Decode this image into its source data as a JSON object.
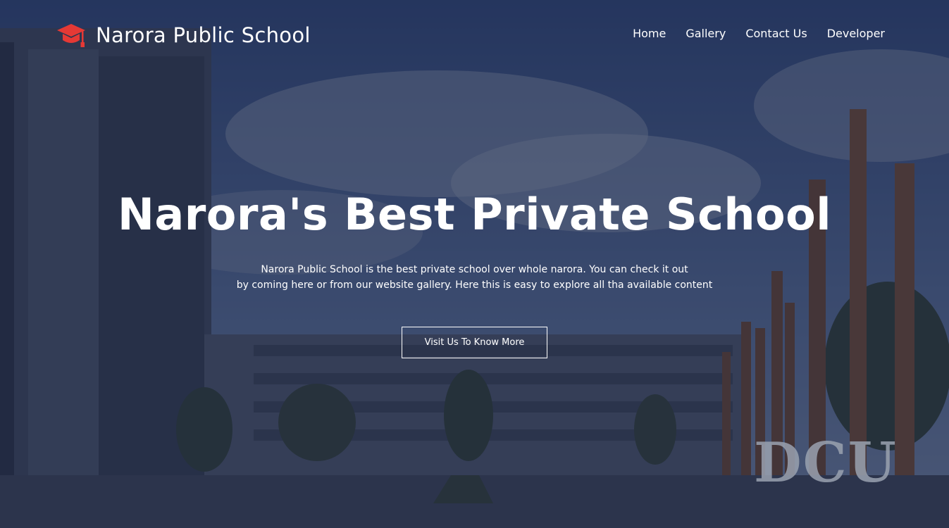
{
  "brand": {
    "name": "Narora Public School",
    "icon": "graduation-cap-icon",
    "icon_color": "#e53935"
  },
  "nav": {
    "items": [
      {
        "label": "Home"
      },
      {
        "label": "Gallery"
      },
      {
        "label": "Contact Us"
      },
      {
        "label": "Developer"
      }
    ]
  },
  "hero": {
    "title": "Narora's Best Private School",
    "description_line1": "Narora Public School is the best private school over whole narora. You can check it out",
    "description_line2": "by coming here or from our website gallery. Here this is easy to explore all tha available content",
    "cta_label": "Visit Us To Know More",
    "sign_text": "DCU"
  },
  "colors": {
    "overlay": "#141e3c",
    "text": "#ffffff",
    "accent": "#e53935"
  }
}
